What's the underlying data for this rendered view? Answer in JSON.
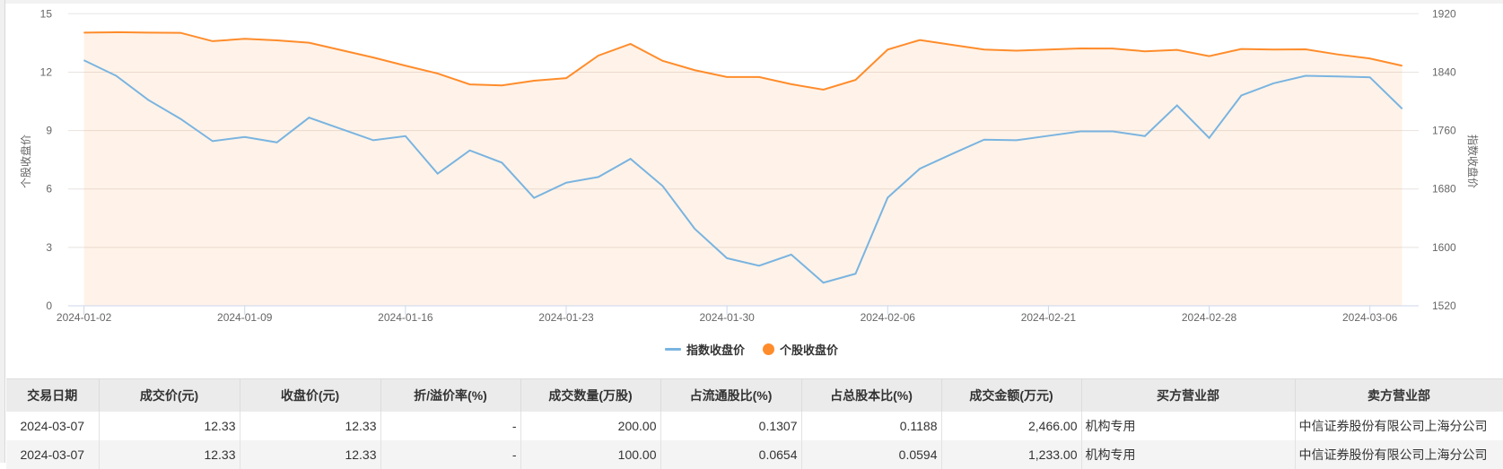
{
  "chart_data": {
    "type": "line",
    "x": [
      "2024-01-02",
      "2024-01-03",
      "2024-01-04",
      "2024-01-05",
      "2024-01-08",
      "2024-01-09",
      "2024-01-10",
      "2024-01-11",
      "2024-01-12",
      "2024-01-15",
      "2024-01-16",
      "2024-01-17",
      "2024-01-18",
      "2024-01-19",
      "2024-01-22",
      "2024-01-23",
      "2024-01-24",
      "2024-01-25",
      "2024-01-26",
      "2024-01-29",
      "2024-01-30",
      "2024-01-31",
      "2024-02-01",
      "2024-02-02",
      "2024-02-05",
      "2024-02-06",
      "2024-02-07",
      "2024-02-08",
      "2024-02-19",
      "2024-02-20",
      "2024-02-21",
      "2024-02-22",
      "2024-02-23",
      "2024-02-26",
      "2024-02-27",
      "2024-02-28",
      "2024-02-29",
      "2024-03-01",
      "2024-03-04",
      "2024-03-05",
      "2024-03-06",
      "2024-03-07"
    ],
    "x_tick_labels": [
      "2024-01-02",
      "2024-01-09",
      "2024-01-16",
      "2024-01-23",
      "2024-01-30",
      "2024-02-06",
      "2024-02-21",
      "2024-02-28",
      "2024-03-06"
    ],
    "ylabel_left": "个股收盘价",
    "ylabel_right": "指数收盘价",
    "ylim_left": [
      0,
      15
    ],
    "yticks_left": [
      "0",
      "3",
      "6",
      "9",
      "12",
      "15"
    ],
    "ylim_right": [
      1520,
      1920
    ],
    "yticks_right": [
      "1520",
      "1600",
      "1680",
      "1760",
      "1840",
      "1920"
    ],
    "grid": true,
    "legend_position": "bottom",
    "series": [
      {
        "name": "指数收盘价",
        "axis": "right",
        "color": "#7ab4e0",
        "area": false,
        "values": [
          1856.2,
          1835.0,
          1801.9,
          1776.1,
          1745.5,
          1751.2,
          1743.8,
          1777.7,
          1762.2,
          1746.7,
          1752.4,
          1700.9,
          1732.8,
          1716.0,
          1667.8,
          1688.6,
          1696.4,
          1721.3,
          1684.1,
          1625.3,
          1585.2,
          1574.9,
          1590.1,
          1551.6,
          1563.9,
          1668.2,
          1707.8,
          1727.9,
          1747.5,
          1746.7,
          1752.8,
          1758.9,
          1758.9,
          1752.4,
          1794.5,
          1749.9,
          1808.0,
          1824.7,
          1835.0,
          1834.1,
          1832.9,
          1790.0
        ]
      },
      {
        "name": "个股收盘价",
        "axis": "left",
        "color": "#ff8c2b",
        "area": true,
        "values": [
          14.03,
          14.05,
          14.03,
          14.02,
          13.59,
          13.71,
          13.63,
          13.51,
          13.13,
          12.75,
          12.33,
          11.93,
          11.37,
          11.32,
          11.56,
          11.69,
          12.85,
          13.45,
          12.58,
          12.1,
          11.75,
          11.75,
          11.38,
          11.1,
          11.6,
          13.16,
          13.65,
          13.4,
          13.16,
          13.1,
          13.16,
          13.22,
          13.21,
          13.07,
          13.14,
          12.82,
          13.19,
          13.16,
          13.17,
          12.91,
          12.7,
          12.33
        ]
      }
    ]
  },
  "legend": {
    "index_label": "指数收盘价",
    "stock_label": "个股收盘价"
  },
  "table": {
    "headers": [
      "交易日期",
      "成交价(元)",
      "收盘价(元)",
      "折/溢价率(%)",
      "成交数量(万股)",
      "占流通股比(%)",
      "占总股本比(%)",
      "成交金额(万元)",
      "买方营业部",
      "卖方营业部"
    ],
    "rows": [
      [
        "2024-03-07",
        "12.33",
        "12.33",
        "-",
        "200.00",
        "0.1307",
        "0.1188",
        "2,466.00",
        "机构专用",
        "中信证券股份有限公司上海分公司"
      ],
      [
        "2024-03-07",
        "12.33",
        "12.33",
        "-",
        "100.00",
        "0.0654",
        "0.0594",
        "1,233.00",
        "机构专用",
        "中信证券股份有限公司上海分公司"
      ]
    ]
  }
}
